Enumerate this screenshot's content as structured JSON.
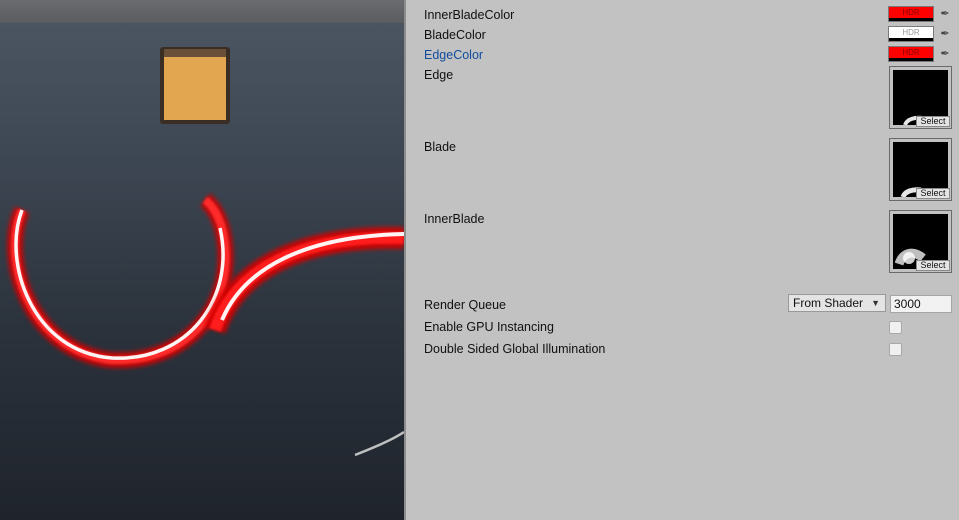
{
  "inspector": {
    "props": {
      "inner_blade_color": {
        "label": "InnerBladeColor",
        "badge": "HDR",
        "swatch": "#ff0000"
      },
      "blade_color": {
        "label": "BladeColor",
        "badge": "HDR",
        "swatch": "#ffffff"
      },
      "edge_color": {
        "label": "EdgeColor",
        "badge": "HDR",
        "swatch": "#ff0000"
      },
      "edge": {
        "label": "Edge",
        "select_label": "Select"
      },
      "blade": {
        "label": "Blade",
        "select_label": "Select"
      },
      "inner_blade": {
        "label": "InnerBlade",
        "select_label": "Select"
      }
    },
    "render_queue": {
      "label": "Render Queue",
      "mode": "From Shader",
      "value": "3000"
    },
    "gpu_instancing": {
      "label": "Enable GPU Instancing",
      "checked": false
    },
    "double_sided_gi": {
      "label": "Double Sided Global Illumination",
      "checked": false
    }
  },
  "icons": {
    "color_picker": "eyedropper-icon",
    "dropdown": "triangle-down-icon"
  },
  "colors": {
    "slash_red": "#ff1010",
    "cube_orange": "#e2a550",
    "highlight_label": "#0f4c9e"
  }
}
